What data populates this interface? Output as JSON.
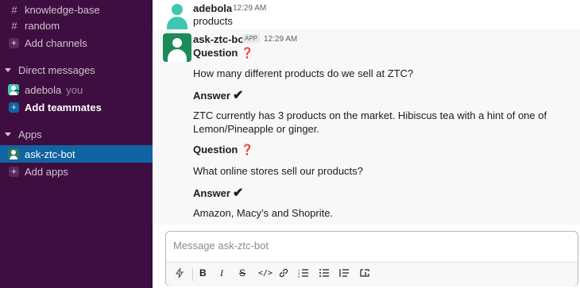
{
  "sidebar": {
    "channels": [
      {
        "label": "knowledge-base"
      },
      {
        "label": "random"
      }
    ],
    "add_channels": "Add channels",
    "direct_messages_header": "Direct messages",
    "dm_user": {
      "name": "adebola",
      "suffix": "you"
    },
    "add_teammates": "Add teammates",
    "apps_header": "Apps",
    "active_app": "ask-ztc-bot",
    "add_apps": "Add apps"
  },
  "messages": {
    "first": {
      "author": "adebola",
      "time": "12:29 AM",
      "text": "products"
    },
    "second": {
      "author": "ask-ztc-bot",
      "badge": "APP",
      "time": "12:29 AM",
      "q1_label": "Question",
      "q1_text": "How many different products do we sell at ZTC?",
      "a1_label": "Answer",
      "a1_line1": "ZTC currently has 3 products on the market. Hibiscus tea with a hint of one of",
      "a1_line2": "Lemon/Pineapple or ginger.",
      "q2_label": "Question",
      "q2_text": "What online stores sell our products?",
      "a2_label": "Answer",
      "a2_text": "Amazon, Macy’s and Shoprite."
    }
  },
  "composer": {
    "placeholder": "Message ask-ztc-bot"
  },
  "icons": {
    "question_mark": "❓",
    "check_mark": "✔"
  },
  "colors": {
    "sidebar_bg": "#3f0e40",
    "active_item": "#1164a3",
    "bot_avatar": "#1d8a5a",
    "user_avatar": "#3ec7b0"
  }
}
